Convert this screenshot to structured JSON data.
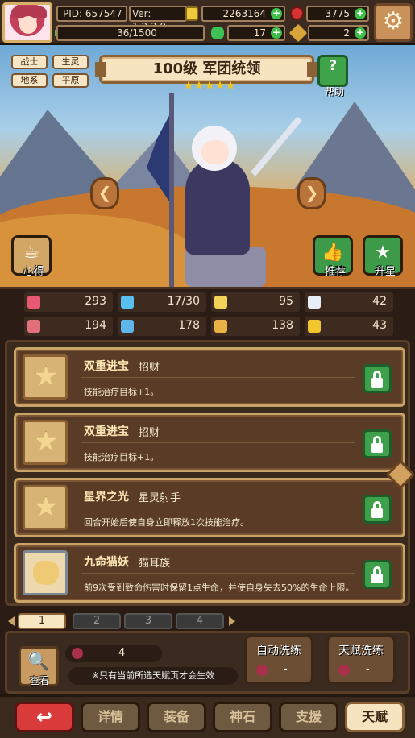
{
  "header": {
    "pid": "PID: 657547",
    "version": "Ver: 1.2.2.0",
    "gold": "2263164",
    "gems": "3775",
    "exp": "36/1500",
    "clover": "17",
    "keys": "2",
    "plus": "+",
    "settings_icon": "⚙"
  },
  "hero": {
    "title": "100级  军团统领",
    "stars": 5,
    "tags": [
      "战士",
      "生灵",
      "地系",
      "平原"
    ],
    "help_icon": "?",
    "help_label": "帮助",
    "notes_label": "心得",
    "recommend_label": "推荐",
    "star_up_label": "升星",
    "prev_icon": "❮",
    "next_icon": "❯"
  },
  "stats": [
    {
      "icon": "heart-icon",
      "value": "293",
      "color": "#e85a73"
    },
    {
      "icon": "drop-icon",
      "value": "17/30",
      "color": "#57c0ef"
    },
    {
      "icon": "trophy-icon",
      "value": "95",
      "color": "#f2d35a"
    },
    {
      "icon": "wing-icon",
      "value": "42",
      "color": "#e8eef7"
    },
    {
      "icon": "shield-icon",
      "value": "194",
      "color": "#e2707c"
    },
    {
      "icon": "book-icon",
      "value": "178",
      "color": "#5fb6e8"
    },
    {
      "icon": "stair-icon",
      "value": "138",
      "color": "#e8b045"
    },
    {
      "icon": "horseshoe-icon",
      "value": "43",
      "color": "#f2c52e"
    }
  ],
  "talents": [
    {
      "name": "双重进宝",
      "sub": "招财",
      "desc": "技能治疗目标+1。",
      "icon": "star-icon"
    },
    {
      "name": "双重进宝",
      "sub": "招财",
      "desc": "技能治疗目标+1。",
      "icon": "star-icon"
    },
    {
      "name": "星界之光",
      "sub": "星灵射手",
      "desc": "回合开始后使自身立即释放1次技能治疗。",
      "icon": "star-icon"
    },
    {
      "name": "九命猫妖",
      "sub": "猫耳族",
      "desc": "前9次受到致命伤害时保留1点生命，并使自身失去50%的生命上限。",
      "icon": "cat-icon"
    }
  ],
  "pages": [
    "1",
    "2",
    "3",
    "4"
  ],
  "active_page": 0,
  "bottom": {
    "view_label": "查看",
    "view_icon": "🔍",
    "cost": "4",
    "note": "※只有当前所选天赋页才会生效",
    "auto_wash": "自动洗练",
    "talent_wash": "天赋洗练",
    "auto_wash_cost": "-",
    "talent_wash_cost": "-"
  },
  "nav": {
    "back_icon": "↩",
    "items": [
      "详情",
      "装备",
      "神石",
      "支援",
      "天赋"
    ],
    "active": 4
  }
}
